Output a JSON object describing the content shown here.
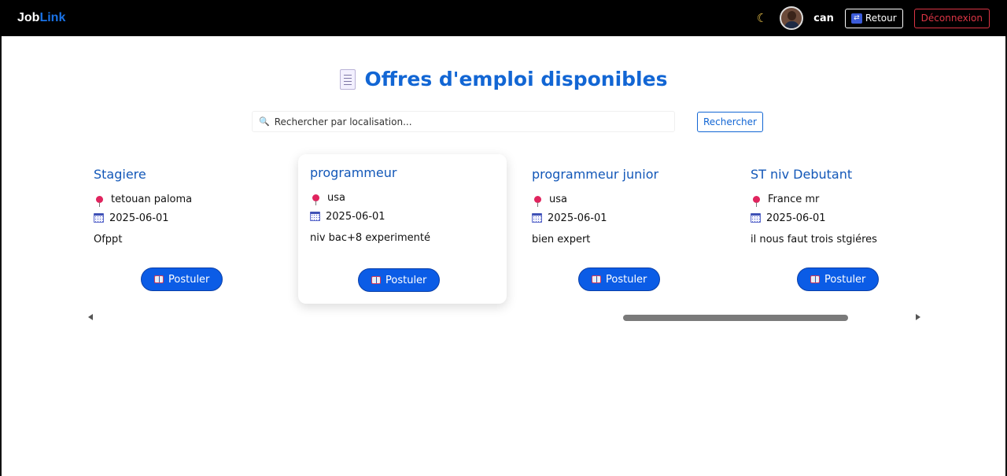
{
  "navbar": {
    "brand_part1": "Job",
    "brand_part2": "Link",
    "theme_icon": "moon-icon",
    "username": "can",
    "back_label": "Retour",
    "logout_label": "Déconnexion"
  },
  "page": {
    "title": "Offres d'emploi disponibles",
    "title_icon": "document-icon"
  },
  "search": {
    "placeholder": "Rechercher par localisation...",
    "value": "",
    "button_label": "Rechercher"
  },
  "jobs": [
    {
      "title": "Stagiere",
      "location": "tetouan paloma",
      "date": "2025-06-01",
      "description": "Ofppt",
      "apply_label": "Postuler"
    },
    {
      "title": "programmeur",
      "location": "usa",
      "date": "2025-06-01",
      "description": "niv bac+8 experimenté",
      "apply_label": "Postuler"
    },
    {
      "title": "programmeur junior",
      "location": "usa",
      "date": "2025-06-01",
      "description": "bien expert",
      "apply_label": "Postuler"
    },
    {
      "title": "ST niv Debutant",
      "location": "France mr",
      "date": "2025-06-01",
      "description": "il nous faut trois stgiéres",
      "apply_label": "Postuler"
    }
  ],
  "colors": {
    "navbar_bg": "#000000",
    "accent": "#1266d4",
    "button_primary": "#0b5ce6",
    "danger": "#dc3545"
  }
}
